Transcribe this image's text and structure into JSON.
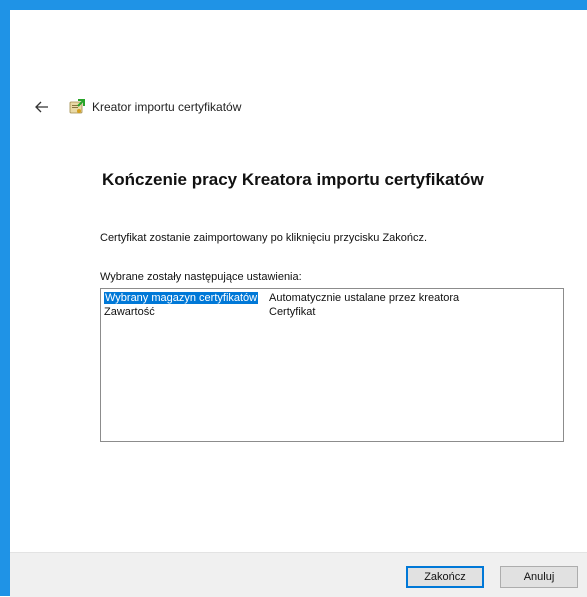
{
  "window": {
    "title": "Kreator importu certyfikatów",
    "back_icon": "left-arrow-icon",
    "app_icon": "certificate-import-icon",
    "accent_color": "#1f93e6"
  },
  "content": {
    "heading": "Kończenie pracy Kreatora importu certyfikatów",
    "info": "Certyfikat zostanie zaimportowany po kliknięciu przycisku Zakończ.",
    "settings_label": "Wybrane zostały następujące ustawienia:",
    "settings": [
      {
        "name": "Wybrany magazyn certyfikatów",
        "value": "Automatycznie ustalane przez kreatora",
        "selected": true
      },
      {
        "name": "Zawartość",
        "value": "Certyfikat",
        "selected": false
      }
    ]
  },
  "footer": {
    "finish_label": "Zakończ",
    "cancel_label": "Anuluj"
  }
}
